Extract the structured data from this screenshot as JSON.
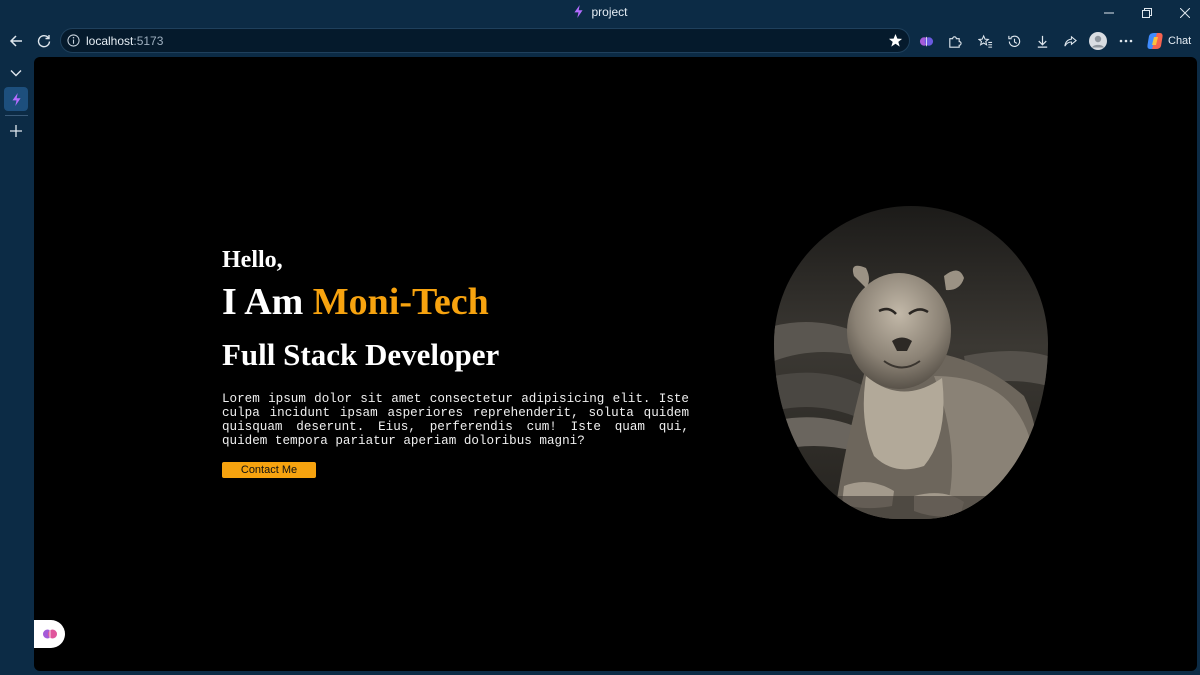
{
  "window": {
    "title": "project"
  },
  "address_bar": {
    "host": "localhost",
    "port": ":5173"
  },
  "toolbar": {
    "chat_label": "Chat"
  },
  "page": {
    "greeting": "Hello,",
    "intro_prefix": "I Am ",
    "name": "Moni-Tech",
    "role": "Full Stack Developer",
    "description": "Lorem ipsum dolor sit amet consectetur adipisicing elit. Iste culpa incidunt ipsam asperiores reprehenderit, soluta quidem quisquam deserunt. Eius, perferendis cum! Iste quam qui, quidem tempora pariatur aperiam doloribus magni?",
    "cta_label": "Contact Me"
  },
  "colors": {
    "accent": "#f7a30f",
    "chrome": "#0c2b45",
    "page_background": "#000000"
  },
  "icons": [
    "vite-logo-icon",
    "minimize-icon",
    "restore-icon",
    "close-icon",
    "back-icon",
    "refresh-icon",
    "info-icon",
    "star-icon",
    "brain-extension-icon",
    "extensions-icon",
    "favorites-icon",
    "history-icon",
    "download-icon",
    "share-icon",
    "profile-icon",
    "more-icon",
    "copilot-icon",
    "chevron-down-icon",
    "plus-icon",
    "lioness-photo"
  ]
}
